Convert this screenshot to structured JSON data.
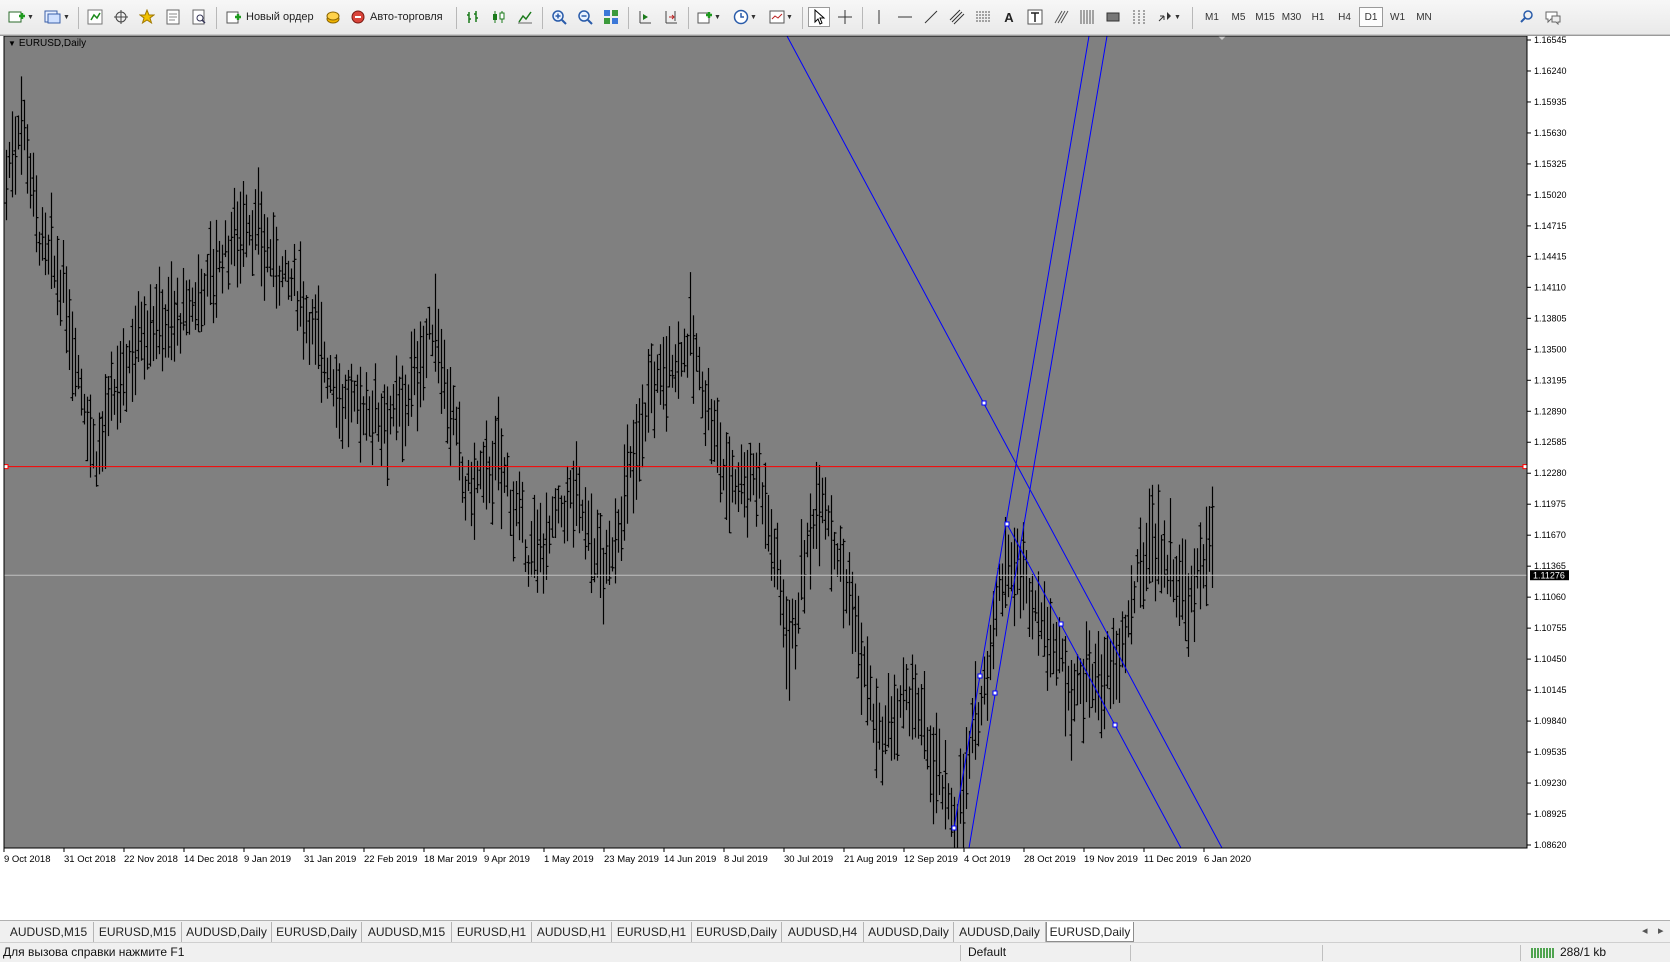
{
  "toolbar": {
    "new_order_label": "Новый ордер",
    "auto_trading_label": "Авто-торговля",
    "timeframes": [
      "M1",
      "M5",
      "M15",
      "M30",
      "H1",
      "H4",
      "D1",
      "W1",
      "MN"
    ],
    "active_timeframe": "D1"
  },
  "chart": {
    "symbol_label": "EURUSD,Daily",
    "price_axis": [
      "1.16545",
      "1.16240",
      "1.15935",
      "1.15630",
      "1.15325",
      "1.15020",
      "1.14715",
      "1.14415",
      "1.14110",
      "1.13805",
      "1.13500",
      "1.13195",
      "1.12890",
      "1.12585",
      "1.12280",
      "1.11975",
      "1.11670",
      "1.11365",
      "1.11060",
      "1.10755",
      "1.10450",
      "1.10145",
      "1.09840",
      "1.09535",
      "1.09230",
      "1.08925",
      "1.08620"
    ],
    "current_price": "1.11276",
    "date_axis": [
      "9 Oct 2018",
      "31 Oct 2018",
      "22 Nov 2018",
      "14 Dec 2018",
      "9 Jan 2019",
      "31 Jan 2019",
      "22 Feb 2019",
      "18 Mar 2019",
      "9 Apr 2019",
      "1 May 2019",
      "23 May 2019",
      "14 Jun 2019",
      "8 Jul 2019",
      "30 Jul 2019",
      "21 Aug 2019",
      "12 Sep 2019",
      "4 Oct 2019",
      "28 Oct 2019",
      "19 Nov 2019",
      "11 Dec 2019",
      "6 Jan 2020"
    ],
    "horizontal_line_price": 1.12345,
    "colors": {
      "background": "#808080",
      "bars": "#000000",
      "trendlines": "#0000ff",
      "horizontal_line": "#ff0000",
      "bid_line": "#c0c0c0"
    }
  },
  "tabs": [
    "AUDUSD,M15",
    "EURUSD,M15",
    "AUDUSD,Daily",
    "EURUSD,Daily",
    "AUDUSD,M15",
    "EURUSD,H1",
    "AUDUSD,H1",
    "EURUSD,H1",
    "EURUSD,Daily",
    "AUDUSD,H4",
    "AUDUSD,Daily",
    "AUDUSD,Daily",
    "EURUSD,Daily"
  ],
  "active_tab_index": 12,
  "status": {
    "help_text": "Для вызова справки нажмите F1",
    "profile": "Default",
    "traffic": "288/1 kb"
  }
}
